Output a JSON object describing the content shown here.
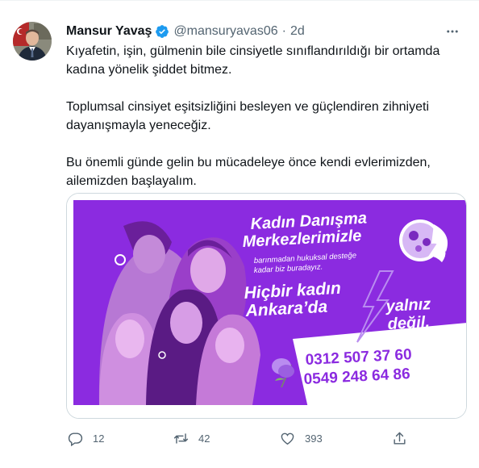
{
  "tweet": {
    "author_name": "Mansur Yavaş",
    "handle": "@mansuryavas06",
    "separator": "·",
    "time": "2d",
    "paragraphs": [
      "Kıyafetin, işin, gülmenin bile cinsiyetle sınıflandırıldığı bir ortamda kadına yönelik şiddet bitmez.",
      "Toplumsal cinsiyet eşitsizliğini besleyen ve güçlendiren zihniyeti dayanışmayla yeneceğiz.",
      "Bu önemli günde gelin bu mücadeleye önce kendi evlerimizden, ailemizden başlayalım."
    ],
    "verified_icon": "verified-badge-icon",
    "more_icon": "more-dots-icon"
  },
  "media": {
    "headline_1": "Kadın Danışma",
    "headline_2": "Merkezlerimizle",
    "sub_1": "barınmadan hukuksal desteğe",
    "sub_2": "kadar biz buradayız.",
    "slogan_1": "Hiçbir kadın",
    "slogan_2": "Ankara’da",
    "slogan_3": "yalnız",
    "slogan_4": "değil.",
    "phone_1": "0312 507 37 60",
    "phone_2": "0549 248 64 86",
    "bg_color": "#8a2be2",
    "panel_color": "#ffffff"
  },
  "actions": {
    "reply_count": "12",
    "retweet_count": "42",
    "like_count": "393"
  },
  "colors": {
    "text": "#0f1419",
    "secondary": "#536471",
    "verified": "#1d9bf0",
    "border": "#cfd9de"
  }
}
